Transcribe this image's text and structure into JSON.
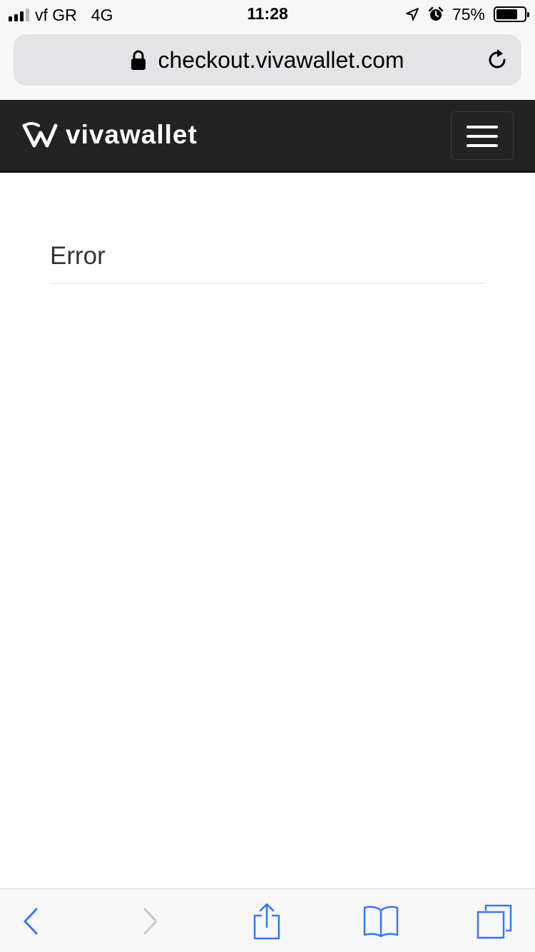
{
  "status_bar": {
    "carrier": "vf GR",
    "network": "4G",
    "time": "11:28",
    "battery_percent": "75%",
    "battery_level": 0.75,
    "icons": [
      "signal-icon",
      "location-arrow-icon",
      "alarm-icon",
      "battery-icon"
    ]
  },
  "browser": {
    "url": "checkout.vivawallet.com",
    "icons": [
      "lock-icon",
      "reload-icon"
    ]
  },
  "header": {
    "brand": "vivawallet",
    "background_color": "#222222",
    "icons": [
      "vivawallet-logo-icon",
      "hamburger-menu-icon"
    ]
  },
  "main": {
    "title": "Error"
  },
  "toolbar": {
    "accent_color": "#3478f6",
    "disabled_color": "#c7c7cc",
    "items": [
      {
        "name": "back",
        "icon": "chevron-left-icon",
        "enabled": true
      },
      {
        "name": "forward",
        "icon": "chevron-right-icon",
        "enabled": false
      },
      {
        "name": "share",
        "icon": "share-icon",
        "enabled": true
      },
      {
        "name": "bookmarks",
        "icon": "book-icon",
        "enabled": true
      },
      {
        "name": "tabs",
        "icon": "tabs-icon",
        "enabled": true
      }
    ]
  }
}
